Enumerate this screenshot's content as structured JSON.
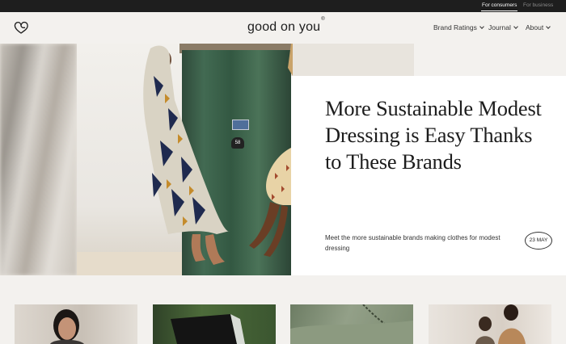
{
  "topbar": {
    "consumers_label": "For consumers",
    "business_label": "For business"
  },
  "header": {
    "brand": "good on you",
    "brand_mark": "®",
    "nav": [
      {
        "label": "Brand Ratings"
      },
      {
        "label": "Journal"
      },
      {
        "label": "About"
      }
    ]
  },
  "feature": {
    "title": "More Sustainable Modest Dressing is Easy Thanks to These Brands",
    "lede": "Meet the more sustainable brands making clothes for modest dressing",
    "date": "23 MAY",
    "door_number": "58"
  },
  "icons": {
    "logo": "heart-logo-icon",
    "nav_chevron": "chevron-down-icon"
  },
  "colors": {
    "topbar": "#1e1e1e",
    "page_bg": "#f3f1ee",
    "card_bg": "#ffffff",
    "text": "#1d1d1d"
  }
}
